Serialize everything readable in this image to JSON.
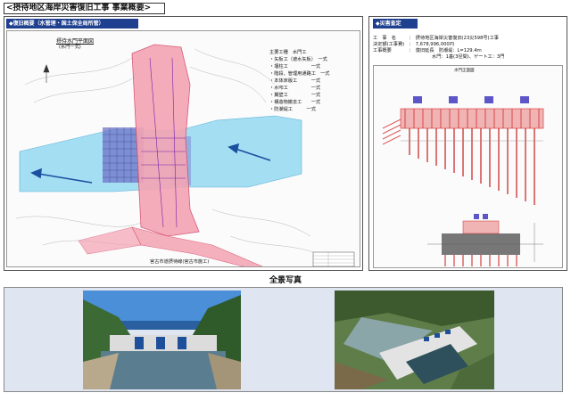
{
  "title": "<摂待地区海岸災害復旧工事 事業概要>",
  "left_section": {
    "label": "◆復旧概要（水管理・国土保全局所管）",
    "plan_title": "摂待水門平面図",
    "plan_subtitle": "(水門一式)",
    "work_heading": "主要工種　水門工",
    "work_items": [
      "・矢板工（遮水矢板）　一式",
      "・堰柱工　　　　　一式",
      "・階段、管理用通路工　一式",
      "・本体床版工　　　一式",
      "・水叩工　　　　　一式",
      "・翼壁工　　　　　一式",
      "・構造物撤去工　　一式",
      "・防潮堤工　　　一式"
    ],
    "bottom_label": "宮古市道摂待線(宮古市施工)"
  },
  "right_section": {
    "label": "◆災害査定",
    "details": [
      [
        "工　事　名",
        "：　摂待地区海岸災害復旧(23災598号)工事"
      ],
      [
        "決定額(工事費)",
        "：　7,678,996,000円"
      ],
      [
        "工事概要",
        "：　復旧延長　防潮堤：L=129.4ｍ"
      ],
      [
        "",
        "水門：1基(3径間)、ゲート工：3門"
      ]
    ],
    "drawing_caption": "水門正面図"
  },
  "photos": {
    "title": "全景写真"
  },
  "colors": {
    "accent": "#1f3f8f",
    "structure": "#f2a0b0",
    "water": "#9fdcf2"
  }
}
